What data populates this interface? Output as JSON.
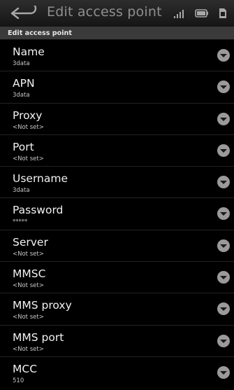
{
  "header": {
    "title": "Edit access point"
  },
  "section": {
    "label": "Edit access point"
  },
  "items": [
    {
      "label": "Name",
      "value": "3data"
    },
    {
      "label": "APN",
      "value": "3data"
    },
    {
      "label": "Proxy",
      "value": "<Not set>"
    },
    {
      "label": "Port",
      "value": "<Not set>"
    },
    {
      "label": "Username",
      "value": "3data"
    },
    {
      "label": "Password",
      "value": "*****"
    },
    {
      "label": "Server",
      "value": "<Not set>"
    },
    {
      "label": "MMSC",
      "value": "<Not set>"
    },
    {
      "label": "MMS proxy",
      "value": "<Not set>"
    },
    {
      "label": "MMS port",
      "value": "<Not set>"
    },
    {
      "label": "MCC",
      "value": "510"
    }
  ],
  "icons": {
    "back": "back-arrow-icon",
    "signal": "signal-strength-icon",
    "battery": "battery-icon",
    "sim": "sim-icon",
    "chevron": "chevron-down-icon"
  },
  "colors": {
    "background": "#000000",
    "section": "#3a3a3a",
    "title": "#8f8f8f"
  }
}
